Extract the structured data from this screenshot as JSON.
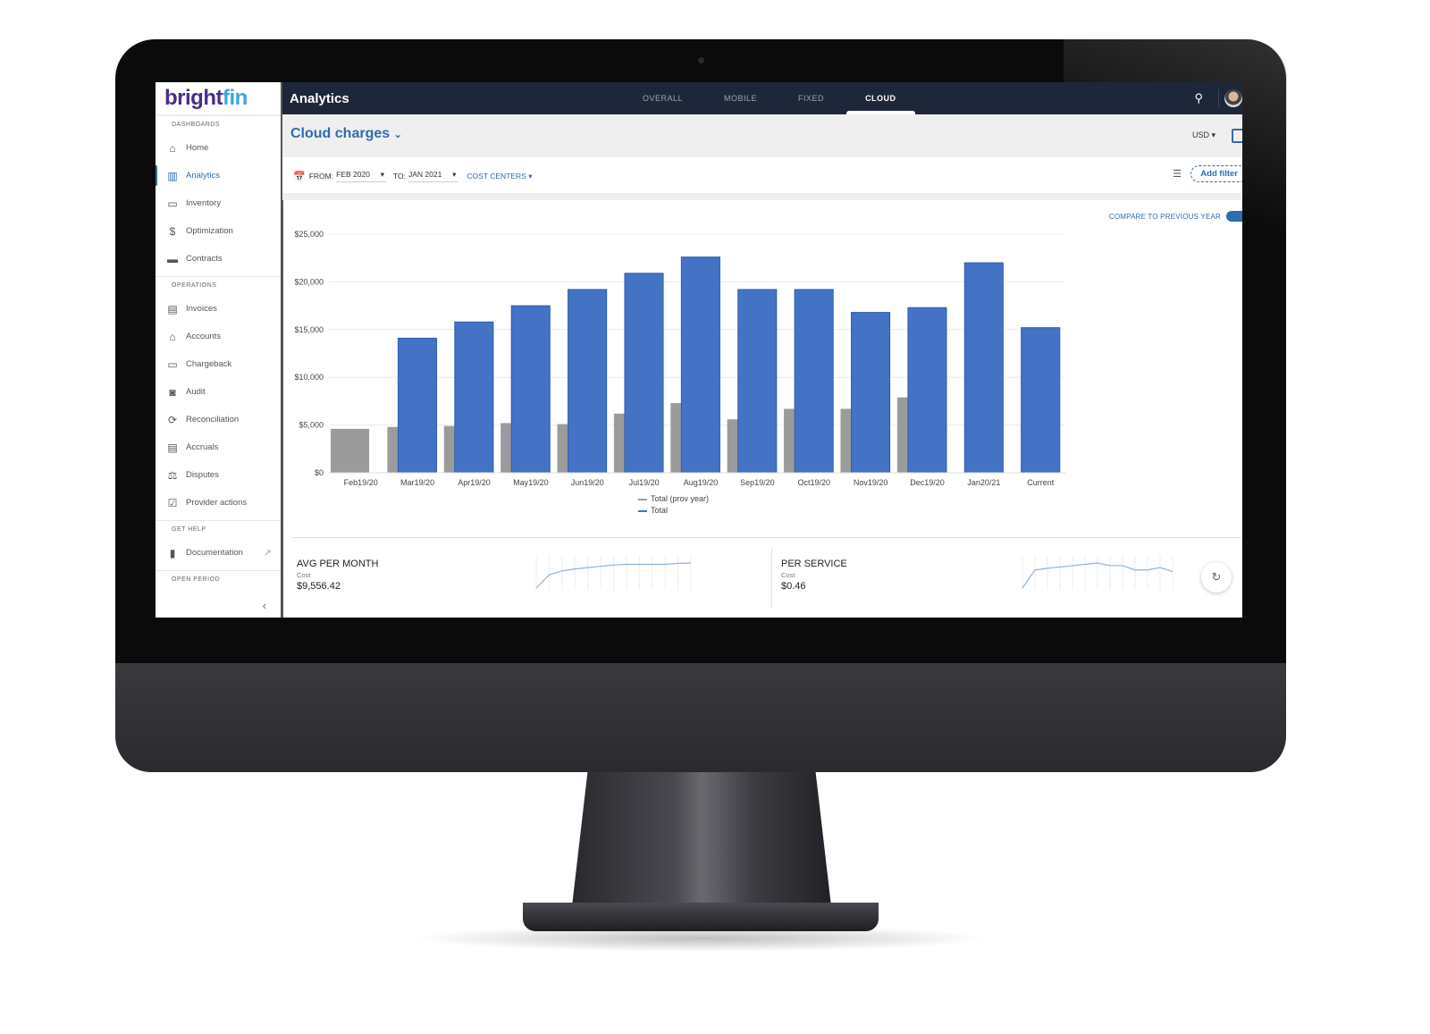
{
  "sidebar": {
    "logo": {
      "part1": "bright",
      "part2": "fin"
    },
    "sections": {
      "dashboards": "DASHBOARDS",
      "operations": "OPERATIONS",
      "get_help": "GET HELP",
      "open_period": "OPEN PERIOD"
    },
    "dashboards": [
      {
        "label": "Home",
        "icon": "home-icon",
        "glyph": "⌂"
      },
      {
        "label": "Analytics",
        "icon": "bar-chart-icon",
        "glyph": "▥",
        "active": true
      },
      {
        "label": "Inventory",
        "icon": "devices-icon",
        "glyph": "▭"
      },
      {
        "label": "Optimization",
        "icon": "dollar-icon",
        "glyph": "$"
      },
      {
        "label": "Contracts",
        "icon": "folder-icon",
        "glyph": "▬"
      }
    ],
    "operations": [
      {
        "label": "Invoices",
        "icon": "document-icon",
        "glyph": "▤"
      },
      {
        "label": "Accounts",
        "icon": "bank-icon",
        "glyph": "⌂"
      },
      {
        "label": "Chargeback",
        "icon": "credit-card-icon",
        "glyph": "▭"
      },
      {
        "label": "Audit",
        "icon": "search-document-icon",
        "glyph": "◙"
      },
      {
        "label": "Reconciliation",
        "icon": "reconcile-icon",
        "glyph": "⟳"
      },
      {
        "label": "Accruals",
        "icon": "clipboard-icon",
        "glyph": "▤"
      },
      {
        "label": "Disputes",
        "icon": "gavel-icon",
        "glyph": "⚖"
      },
      {
        "label": "Provider actions",
        "icon": "clipboard-check-icon",
        "glyph": "☑"
      }
    ],
    "help": [
      {
        "label": "Documentation",
        "icon": "book-icon",
        "glyph": "▮"
      }
    ]
  },
  "topbar": {
    "title": "Analytics",
    "tabs": [
      {
        "label": "OVERALL"
      },
      {
        "label": "MOBILE"
      },
      {
        "label": "FIXED"
      },
      {
        "label": "CLOUD",
        "active": true
      }
    ]
  },
  "subheader": {
    "title": "Cloud charges",
    "currency": "USD"
  },
  "filters": {
    "from_label": "FROM:",
    "from_value": "FEB 2020",
    "to_label": "TO:",
    "to_value": "JAN 2021",
    "cost_centers": "COST CENTERS",
    "add_filter": "Add filter"
  },
  "compare": {
    "label": "COMPARE TO PREVIOUS YEAR",
    "enabled": true
  },
  "chart_data": {
    "type": "bar",
    "title": "",
    "xlabel": "",
    "ylabel": "",
    "ylim": [
      0,
      25000
    ],
    "yticks": [
      "$0",
      "$5,000",
      "$10,000",
      "$15,000",
      "$20,000",
      "$25,000"
    ],
    "ytick_values": [
      0,
      5000,
      10000,
      15000,
      20000,
      25000
    ],
    "grid": true,
    "legend_position": "bottom",
    "categories": [
      "Feb19/20",
      "Mar19/20",
      "Apr19/20",
      "May19/20",
      "Jun19/20",
      "Jul19/20",
      "Aug19/20",
      "Sep19/20",
      "Oct19/20",
      "Nov19/20",
      "Dec19/20",
      "Jan20/21",
      "Current"
    ],
    "series": [
      {
        "name": "Total (prov year)",
        "color": "#9b9b9b",
        "values": [
          4600,
          4800,
          4900,
          5200,
          5100,
          6200,
          7300,
          5600,
          6700,
          6700,
          7900,
          null,
          null
        ]
      },
      {
        "name": "Total",
        "color": "#4472c4",
        "values": [
          null,
          14100,
          15800,
          17500,
          19200,
          20900,
          22600,
          19200,
          19200,
          16800,
          17300,
          22000,
          15200
        ]
      }
    ]
  },
  "kpis": [
    {
      "title": "AVG PER MONTH",
      "sub": "Cost",
      "value": "$9,556.42",
      "sparkline": [
        0,
        40,
        52,
        58,
        62,
        66,
        70,
        72,
        72,
        72,
        72,
        75,
        76
      ]
    },
    {
      "title": "PER SERVICE",
      "sub": "Cost",
      "value": "$0.46",
      "sparkline": [
        0,
        55,
        60,
        64,
        68,
        72,
        76,
        68,
        68,
        55,
        55,
        62,
        50
      ]
    }
  ],
  "colors": {
    "accent": "#2f6bb0",
    "topbar": "#1e2739",
    "bar_current": "#4472c4",
    "bar_prev": "#9b9b9b"
  }
}
